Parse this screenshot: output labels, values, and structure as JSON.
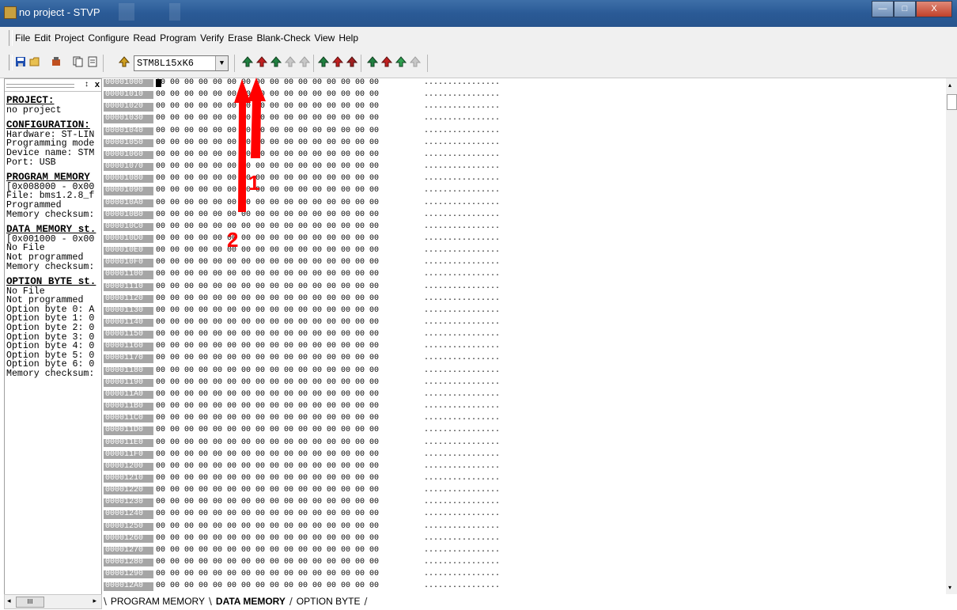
{
  "window": {
    "title": "no project - STVP",
    "min_label": "—",
    "max_label": "□",
    "close_label": "X"
  },
  "menu": [
    "File",
    "Edit",
    "Project",
    "Configure",
    "Read",
    "Program",
    "Verify",
    "Erase",
    "Blank-Check",
    "View",
    "Help"
  ],
  "toolbar": {
    "device": "STM8L15xK6"
  },
  "left_panel": {
    "pin_glyph": "↕",
    "close_glyph": "x",
    "lines": [
      {
        "t": "PROJECT:",
        "h": true
      },
      {
        "t": "no project"
      },
      {
        "t": "CONFIGURATION:",
        "h": true
      },
      {
        "t": "Hardware: ST-LIN"
      },
      {
        "t": "Programming mode"
      },
      {
        "t": "Device name: STM"
      },
      {
        "t": "Port: USB"
      },
      {
        "t": "PROGRAM MEMORY",
        "h": true
      },
      {
        "t": "[0x008000 - 0x00"
      },
      {
        "t": "File: bms1.2.8_f"
      },
      {
        "t": "Programmed"
      },
      {
        "t": "Memory checksum:"
      },
      {
        "t": "DATA MEMORY st.",
        "h": true
      },
      {
        "t": "[0x001000 - 0x00"
      },
      {
        "t": "No File"
      },
      {
        "t": "Not programmed"
      },
      {
        "t": "Memory checksum:"
      },
      {
        "t": "OPTION BYTE st.",
        "h": true
      },
      {
        "t": "No File"
      },
      {
        "t": "Not programmed"
      },
      {
        "t": "Option byte 0: A"
      },
      {
        "t": "Option byte 1: 0"
      },
      {
        "t": "Option byte 2: 0"
      },
      {
        "t": "Option byte 3: 0"
      },
      {
        "t": "Option byte 4: 0"
      },
      {
        "t": "Option byte 5: 0"
      },
      {
        "t": "Option byte 6: 0"
      },
      {
        "t": "Memory checksum:"
      }
    ]
  },
  "hex_view": {
    "addresses": [
      "00001000",
      "00001010",
      "00001020",
      "00001030",
      "00001040",
      "00001050",
      "00001060",
      "00001070",
      "00001080",
      "00001090",
      "000010A0",
      "000010B0",
      "000010C0",
      "000010D0",
      "000010E0",
      "000010F0",
      "00001100",
      "00001110",
      "00001120",
      "00001130",
      "00001140",
      "00001150",
      "00001160",
      "00001170",
      "00001180",
      "00001190",
      "000011A0",
      "000011B0",
      "000011C0",
      "000011D0",
      "000011E0",
      "000011F0",
      "00001200",
      "00001210",
      "00001220",
      "00001230",
      "00001240",
      "00001250",
      "00001260",
      "00001270",
      "00001280",
      "00001290",
      "000012A0"
    ],
    "bytes_row": "00 00 00 00 00 00 00 00 00 00 00 00 00 00 00 00",
    "ascii_row": "................"
  },
  "tabs": [
    {
      "label": "PROGRAM MEMORY",
      "active": false
    },
    {
      "label": "DATA MEMORY",
      "active": true
    },
    {
      "label": "OPTION BYTE",
      "active": false
    }
  ],
  "annotations": {
    "label_1": "1",
    "label_2": "2",
    "color": "#ff0000"
  },
  "scroll_glyphs": {
    "left": "◂",
    "right": "▸",
    "up": "▴",
    "down": "▾",
    "thumb": "III"
  }
}
